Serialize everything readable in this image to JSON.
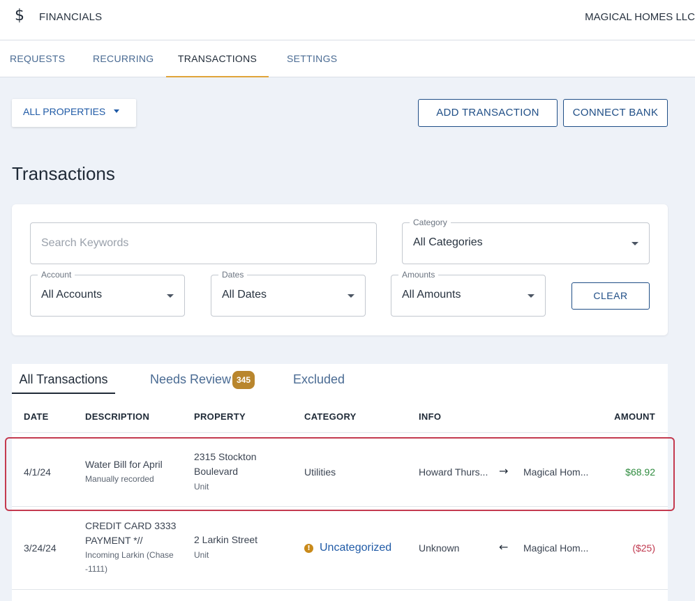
{
  "header": {
    "icon": "dollar-icon",
    "app_name": "FINANCIALS",
    "company": "MAGICAL HOMES LLC"
  },
  "nav_tabs": [
    {
      "label": "REQUESTS"
    },
    {
      "label": "RECURRING"
    },
    {
      "label": "TRANSACTIONS",
      "active": true
    },
    {
      "label": "SETTINGS"
    }
  ],
  "toolbar": {
    "property_select": "ALL PROPERTIES",
    "add_transaction": "ADD TRANSACTION",
    "connect_bank": "CONNECT BANK"
  },
  "page_title": "Transactions",
  "filters": {
    "search_placeholder": "Search Keywords",
    "category": {
      "label": "Category",
      "value": "All Categories"
    },
    "account": {
      "label": "Account",
      "value": "All Accounts"
    },
    "dates": {
      "label": "Dates",
      "value": "All Dates"
    },
    "amounts": {
      "label": "Amounts",
      "value": "All Amounts"
    },
    "clear": "CLEAR"
  },
  "sub_tabs": {
    "all": "All Transactions",
    "review": "Needs Review",
    "review_count": "345",
    "excluded": "Excluded"
  },
  "columns": {
    "date": "DATE",
    "description": "DESCRIPTION",
    "property": "PROPERTY",
    "category": "CATEGORY",
    "info": "INFO",
    "amount": "AMOUNT"
  },
  "rows": [
    {
      "date": "4/1/24",
      "description": "Water Bill for April",
      "description_sub": "Manually recorded",
      "property_line1": "2315 Stockton",
      "property_line2": "Boulevard",
      "property_sub": "Unit",
      "category": "Utilities",
      "info_from": "Howard Thurs...",
      "direction_icon": "arrow-right-icon",
      "info_to": "Magical Hom...",
      "amount": "$68.92",
      "amount_color": "#2e8b3e"
    },
    {
      "date": "3/24/24",
      "description_line1": "CREDIT CARD 3333",
      "description_line2": "PAYMENT *//",
      "description_sub1": "Incoming Larkin (Chase",
      "description_sub2": "-1111)",
      "property_line1": "2 Larkin Street",
      "property_sub": "Unit",
      "category": "Uncategorized",
      "category_icon": "info-icon",
      "info_from": "Unknown",
      "direction_icon": "arrow-left-icon",
      "info_to": "Magical Hom...",
      "amount": "($25)",
      "amount_color": "#c0394f"
    }
  ]
}
